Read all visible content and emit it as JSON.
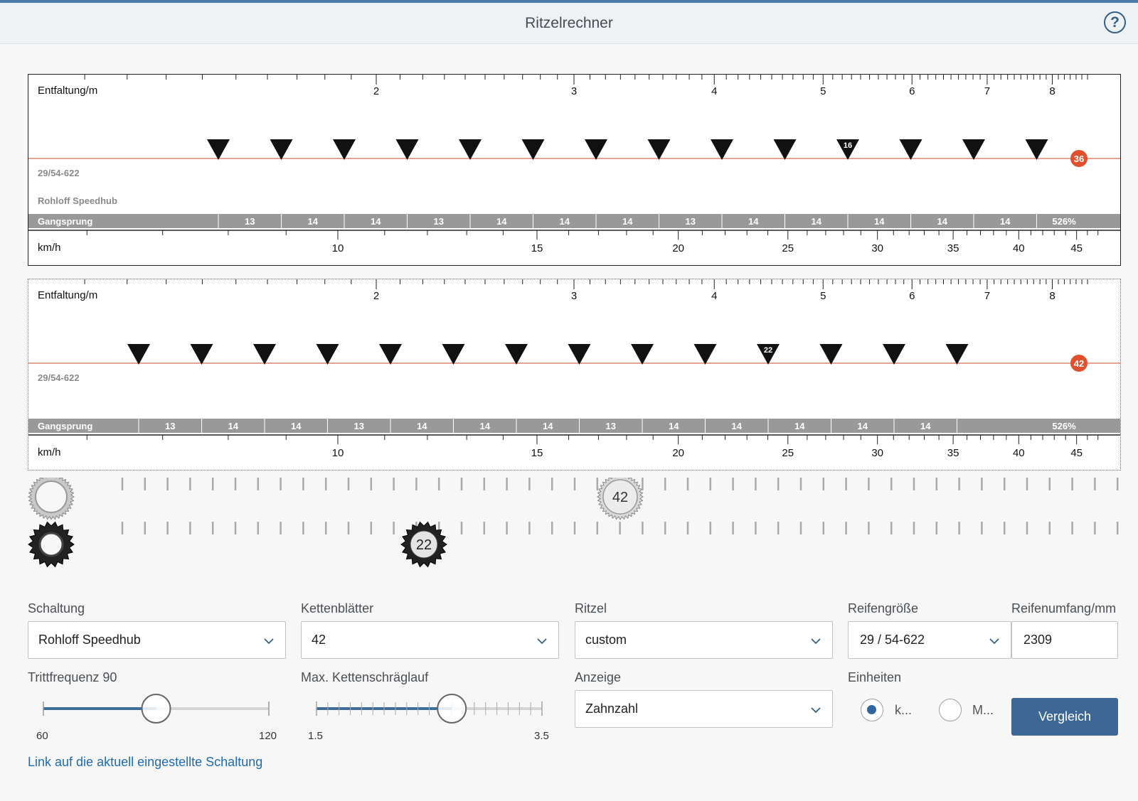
{
  "header": {
    "title": "Ritzelrechner",
    "help_icon": "help-circle-icon",
    "help_glyph": "?"
  },
  "charts": [
    {
      "entfaltung_label": "Entfaltung/m",
      "entfaltung_ticks": [
        "2",
        "3",
        "4",
        "5",
        "6",
        "7",
        "8"
      ],
      "tire_label": "29/54-622",
      "hub_label": "Rohloff Speedhub",
      "chainring_badge": "36",
      "highlight_marker": "16",
      "gangsprung_label": "Gangsprung",
      "gangsprung_values": [
        "13",
        "14",
        "14",
        "13",
        "14",
        "14",
        "14",
        "13",
        "14",
        "14",
        "14",
        "14",
        "14"
      ],
      "gangsprung_total": "526%",
      "kmh_label": "km/h",
      "kmh_ticks": [
        "10",
        "15",
        "20",
        "25",
        "30",
        "35",
        "40",
        "45"
      ]
    },
    {
      "entfaltung_label": "Entfaltung/m",
      "entfaltung_ticks": [
        "2",
        "3",
        "4",
        "5",
        "6",
        "7",
        "8"
      ],
      "tire_label": "29/54-622",
      "hub_label": "",
      "chainring_badge": "42",
      "highlight_marker": "22",
      "gangsprung_label": "Gangsprung",
      "gangsprung_values": [
        "13",
        "14",
        "14",
        "13",
        "14",
        "14",
        "14",
        "13",
        "14",
        "14",
        "14",
        "14",
        "14"
      ],
      "gangsprung_total": "526%",
      "kmh_label": "km/h",
      "kmh_ticks": [
        "10",
        "15",
        "20",
        "25",
        "30",
        "35",
        "40",
        "45"
      ]
    }
  ],
  "selector": {
    "chainring_value": "42",
    "sprocket_value": "22",
    "chainring_icon": "chainring-icon",
    "sprocket_icon": "sprocket-icon"
  },
  "form": {
    "schaltung": {
      "label": "Schaltung",
      "value": "Rohloff Speedhub"
    },
    "kettenblaetter": {
      "label": "Kettenblätter",
      "value": "42"
    },
    "ritzel": {
      "label": "Ritzel",
      "value": "custom"
    },
    "reifengroesse": {
      "label": "Reifengröße",
      "value": "29 / 54-622"
    },
    "reifenumfang": {
      "label": "Reifenumfang/mm",
      "value": "2309"
    },
    "trittfrequenz": {
      "label": "Trittfrequenz 90",
      "min": "60",
      "max": "120",
      "value": 90,
      "range": [
        60,
        120
      ]
    },
    "kettenschraeglauf": {
      "label": "Max. Kettenschräglauf",
      "min": "1.5",
      "max": "3.5",
      "value": 2.7,
      "range": [
        1.5,
        3.5
      ]
    },
    "anzeige": {
      "label": "Anzeige",
      "value": "Zahnzahl"
    },
    "einheiten": {
      "label": "Einheiten",
      "option_kmh": "k...",
      "option_mph": "M...",
      "selected": "kmh"
    },
    "vergleich_button": "Vergleich"
  },
  "link_text": "Link auf die aktuell eingestellte Schaltung",
  "colors": {
    "accent": "#3d6895",
    "badge": "#e0502e",
    "gangsprung_bar": "#999999"
  }
}
